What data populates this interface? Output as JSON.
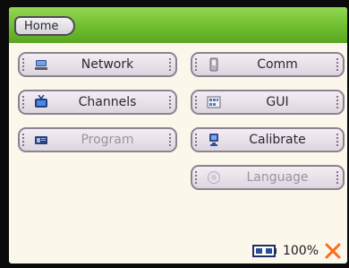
{
  "header": {
    "home_label": "Home"
  },
  "menu": {
    "network": "Network",
    "channels": "Channels",
    "program": "Program",
    "comm": "Comm",
    "gui": "GUI",
    "calibrate": "Calibrate",
    "language": "Language"
  },
  "status": {
    "battery_percent": "100%"
  },
  "colors": {
    "header_green": "#7bc53a",
    "screen_bg": "#fbf7ea",
    "close_orange": "#ff6a1a"
  },
  "icons": {
    "network": "network-icon",
    "channels": "tv-icon",
    "program": "program-icon",
    "comm": "comm-icon",
    "gui": "grid-icon",
    "calibrate": "calibrate-icon",
    "language": "language-icon",
    "battery": "battery-icon",
    "close": "close-icon"
  }
}
